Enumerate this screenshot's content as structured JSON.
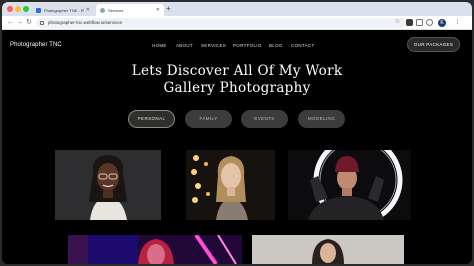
{
  "browser": {
    "tabs": [
      {
        "title": "Photographer TNE - Photog"
      },
      {
        "title": "Services"
      }
    ],
    "url": "photographer-tnc.webflow.io/services",
    "profile_initial": "K"
  },
  "site": {
    "logo": "Photographer TNC",
    "nav": [
      "HOME",
      "ABOUT",
      "SERVICES",
      "PORTFOLIO",
      "BLOG",
      "CONTACT"
    ],
    "cta": "OUR PACKAGES",
    "hero_line1": "Lets Discover All Of My Work",
    "hero_line2": "Gallery Photography",
    "filters": [
      "PERSONAL",
      "FAMILY",
      "EVENTS",
      "MODELING"
    ],
    "active_filter": "PERSONAL"
  },
  "colors": {
    "accent_border": "#8c8c78",
    "page_bg": "#000000"
  }
}
